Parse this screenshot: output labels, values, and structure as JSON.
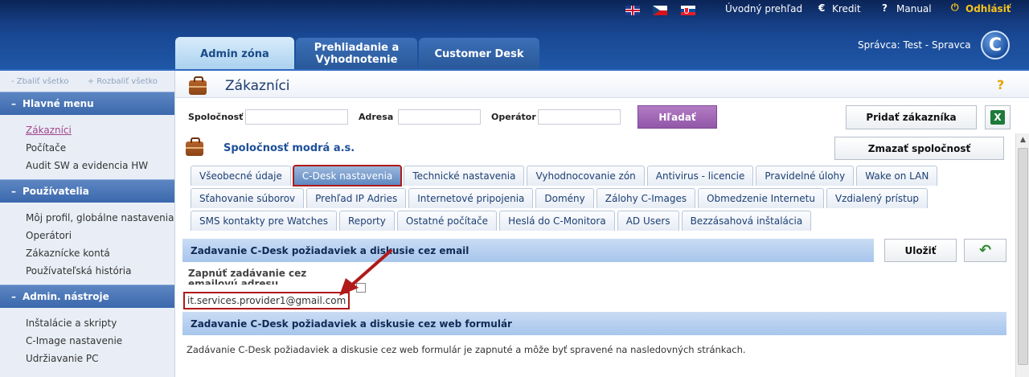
{
  "top": {
    "flags": [
      "en-flag",
      "cz-flag",
      "sk-flag"
    ],
    "home_link": "Úvodný prehľad",
    "kredit_link": "Kredit",
    "manual_link": "Manual",
    "logout_link": "Odhlásiť",
    "euro_symbol": "€",
    "help_symbol": "?",
    "power_symbol": "⏻"
  },
  "main_tabs": {
    "admin": "Admin zóna",
    "prehliadanie": "Prehliadanie a Vyhodnotenie",
    "customer": "Customer Desk"
  },
  "manager": {
    "label": "Správca:",
    "name": "Test - Spravca"
  },
  "logo_letter": "C",
  "sidebar": {
    "collapse_all": "Zbaliť všetko",
    "expand_all": "Rozbaliť všetko",
    "sections": [
      {
        "title": "Hlavné menu",
        "items": [
          "Zákazníci",
          "Počítače",
          "Audit SW a evidencia HW"
        ]
      },
      {
        "title": "Používatelia",
        "items": [
          "Môj profil, globálne nastavenia",
          "Operátori",
          "Zákaznícke kontá",
          "Používateľská história"
        ]
      },
      {
        "title": "Admin. nástroje",
        "items": [
          "Inštalácie a skripty",
          "C-Image nastavenie",
          "Udržiavanie PC"
        ]
      }
    ]
  },
  "page": {
    "title": "Zákazníci",
    "help": "?"
  },
  "filter": {
    "company_label": "Spoločnosť",
    "company_value": "",
    "address_label": "Adresa",
    "address_value": "",
    "operator_label": "Operátor",
    "operator_value": "",
    "search_button": "Hľadať",
    "add_customer_button": "Pridať zákazníka",
    "excel_icon": "X"
  },
  "company": {
    "title": "Spoločnosť modrá a.s.",
    "delete_button": "Zmazať spoločnosť"
  },
  "subtabs": {
    "row1": [
      "Všeobecné údaje",
      "C-Desk nastavenia",
      "Technické nastavenia",
      "Vyhodnocovanie zón",
      "Antivirus - licencie",
      "Pravidelné úlohy",
      "Wake on LAN"
    ],
    "row2": [
      "Sťahovanie súborov",
      "Prehľad IP Adries",
      "Internetové pripojenia",
      "Domény",
      "Zálohy C-Images",
      "Obmedzenie Internetu",
      "Vzdialený prístup"
    ],
    "row3": [
      "SMS kontakty pre Watches",
      "Reporty",
      "Ostatné počítače",
      "Heslá do C-Monitora",
      "AD Users",
      "Bezzásahová inštalácia"
    ],
    "active": "C-Desk nastavenia"
  },
  "email_section": {
    "title": "Zadavanie C-Desk požiadaviek a diskusie cez email",
    "save_button": "Uložiť",
    "enable_label": "Zapnúť zadávanie cez emailovú adresu",
    "email_value": "it.services.provider1@gmail.com",
    "enabled": false
  },
  "web_section": {
    "title": "Zadavanie C-Desk požiadaviek a diskusie cez web formulár",
    "description": "Zadávanie C-Desk požiadaviek a diskusie cez web formulár je zapnuté a môže byť spravené na nasledovných stránkach."
  },
  "colors": {
    "header_blue": "#1a4a96",
    "accent_purple": "#9257a8",
    "highlight_red": "#b01a1a",
    "section_blue": "#a7c5ec"
  }
}
